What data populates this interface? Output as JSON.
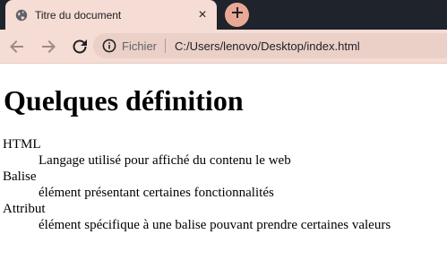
{
  "browser": {
    "tab": {
      "title": "Titre du document",
      "close_symbol": "×"
    },
    "newtab_symbol": "+",
    "omnibox": {
      "security_chip": "Fichier",
      "url": "C:/Users/lenovo/Desktop/index.html"
    },
    "icons": [
      "globe-icon",
      "close-icon",
      "plus-icon",
      "back-icon",
      "forward-icon",
      "reload-icon",
      "info-icon"
    ],
    "colors": {
      "tab_strip": "#1f232b",
      "toolbar": "#f5dcd4",
      "newtab_button": "#e8a896"
    }
  },
  "page": {
    "heading": "Quelques définition",
    "definitions": [
      {
        "term": "HTML",
        "description": "Langage utilisé pour affiché du contenu le web"
      },
      {
        "term": "Balise",
        "description": "élément présentant certaines fonctionnalités"
      },
      {
        "term": "Attribut",
        "description": "élément spécifique à une balise pouvant prendre certaines valeurs"
      }
    ]
  }
}
